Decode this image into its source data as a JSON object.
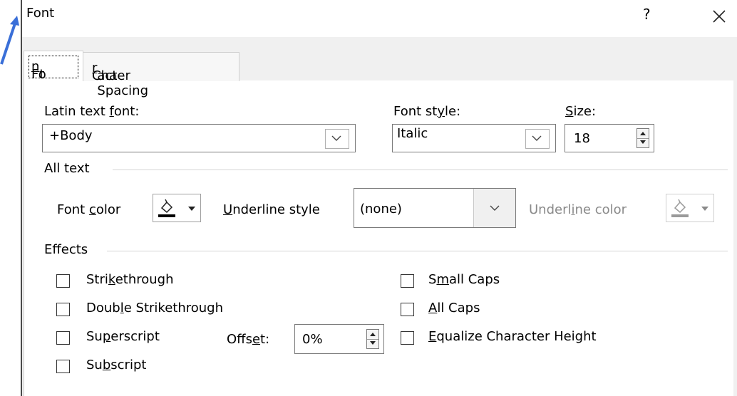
{
  "window": {
    "title": "Font",
    "help_symbol": "?"
  },
  "tabs": [
    {
      "label_pre": "Fo",
      "label_u": "n",
      "label_post": "t",
      "active": true
    },
    {
      "label_pre": "Cha",
      "label_u": "r",
      "label_post": "acter Spacing",
      "active": false
    }
  ],
  "latin_font": {
    "label_pre": "Latin text ",
    "label_u": "f",
    "label_post": "ont:",
    "value": "+Body"
  },
  "font_style": {
    "label_pre": "Font st",
    "label_u": "y",
    "label_post": "le:",
    "value": "Italic"
  },
  "size": {
    "label_pre": "",
    "label_u": "S",
    "label_post": "ize:",
    "value": "18"
  },
  "all_text": {
    "header": "All text",
    "font_color": {
      "label_pre": "Font ",
      "label_u": "c",
      "label_post": "olor"
    },
    "underline_style": {
      "label_pre": "",
      "label_u": "U",
      "label_post": "nderline style",
      "value": "(none)"
    },
    "underline_color": {
      "label_pre": "Underl",
      "label_u": "i",
      "label_post": "ne color"
    }
  },
  "effects": {
    "header": "Effects",
    "strikethrough": {
      "pre": "Stri",
      "u": "k",
      "post": "ethrough",
      "checked": false
    },
    "double_strikethrough": {
      "pre": "Doub",
      "u": "l",
      "post": "e Strikethrough",
      "checked": false
    },
    "superscript": {
      "pre": "Su",
      "u": "p",
      "post": "erscript",
      "checked": false
    },
    "subscript": {
      "pre": "Su",
      "u": "b",
      "post": "script",
      "checked": false
    },
    "small_caps": {
      "pre": "S",
      "u": "m",
      "post": "all Caps",
      "checked": false
    },
    "all_caps": {
      "pre": "",
      "u": "A",
      "post": "ll Caps",
      "checked": false
    },
    "equalize_height": {
      "pre": "",
      "u": "E",
      "post": "qualize Character Height",
      "checked": false
    },
    "offset": {
      "pre": "Offs",
      "u": "e",
      "post": "t:",
      "value": "0%"
    }
  },
  "colors": {
    "accent_arrow": "#3a6fd8",
    "font_color_bar": "#000000",
    "underline_color_bar": "#9a9a9a"
  }
}
